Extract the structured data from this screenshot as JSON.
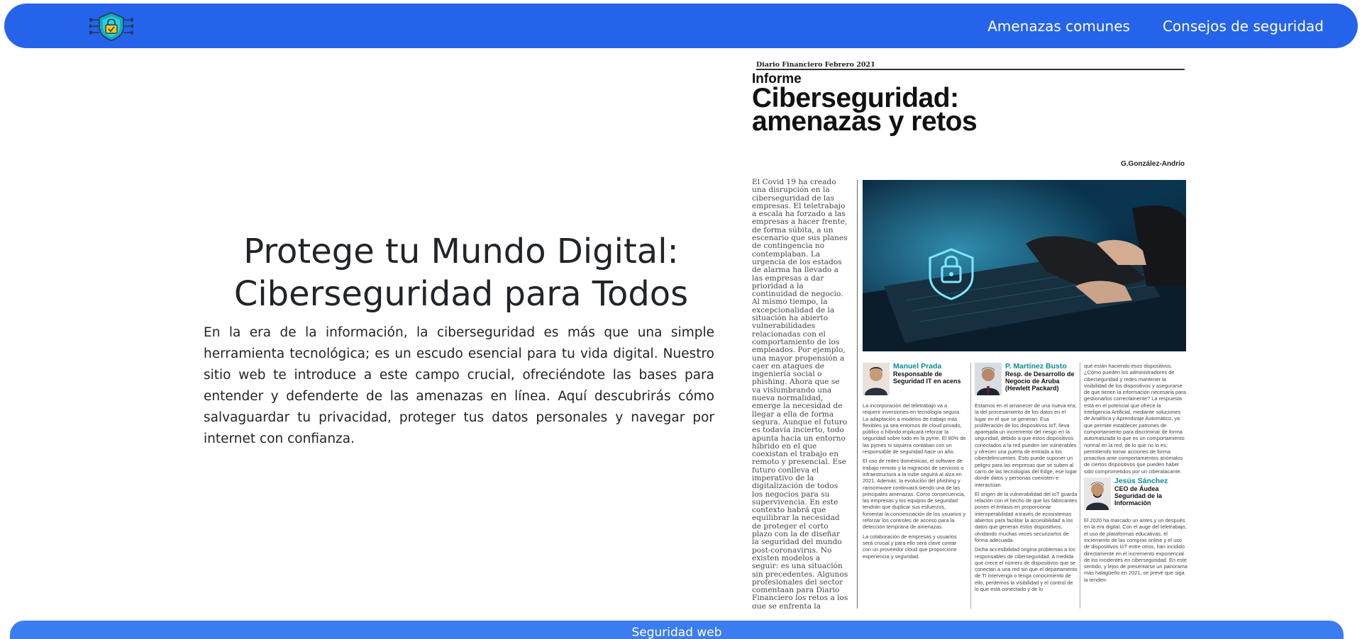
{
  "header": {
    "logo_icon": "shield-lock-icon",
    "nav": [
      {
        "label": "Amenazas comunes"
      },
      {
        "label": "Consejos de seguridad"
      }
    ]
  },
  "hero": {
    "title_line1": "Protege tu Mundo Digital:",
    "title_line2": "Ciberseguridad para Todos",
    "paragraph": "En la era de la información, la ciberseguridad es más que una simple herramienta tecnológica; es un escudo esencial para tu vida digital. Nuestro sitio web te introduce a este campo crucial, ofreciéndote las bases para entender y defenderte de las amenazas en línea. Aquí descubrirás cómo salvaguardar tu privacidad, proteger tus datos personales y navegar por internet con confianza."
  },
  "article": {
    "masthead": "Diario Financiero Febrero 2021",
    "kicker": "Informe",
    "headline_line1": "Ciberseguridad:",
    "headline_line2": "amenazas y retos",
    "byline": "G.González-Andrío",
    "column1": "El Covid 19 ha creado una disrupción en la ciberseguridad de las empresas. El teletrabajo a escala ha forzado a las empresas a hacer frente, de forma súbita, a un escenario que sus planes de contingencia no contemplaban. La urgencia de los estados de alarma ha llevado a las empresas a dar prioridad a la continuidad de negocio. Al mismo tiempo, la excepcionalidad de la situación ha abierto vulnerabilidades relacionadas con el comportamiento de los empleados. Por ejemplo, una mayor propensión a caer en ataques de ingeniería social o phishing. Ahora que se va vislumbrando una nueva normalidad, emerge la necesidad de llegar a ella de forma segura. Aunque el futuro es todavía incierto, todo apunta hacia un entorno híbrido en el que coexistan el trabajo en remoto y presencial. Ese futuro conlleva el imperativo de la digitalización de todos los negocios para su supervivencia. En este contexto habrá que equilibrar la necesidad de proteger el corto plazo con la de diseñar la seguridad del mundo post-coronavirus. No existen modelos a seguir: es una situación sin precedentes. Algunos profesionales del sector comentaan para Diario Financiero los retos a los que se enfrenta la Ciberseguridad tanto en nuestro país como en el resto del mundo.",
    "profiles": [
      {
        "name": "Manuel Prada",
        "role": "Responsable de Seguridad IT en acens",
        "text": [
          "La incorporación del teletrabajo va a requerir inversiones en tecnología segura. La adaptación a modelos de trabajo más flexibles ya sea entornos de cloud privado, público o híbrido implicará reforzar la seguridad sobre todo en la pyme. El 90% de las pymes ni siquiera contaban con un responsable de seguridad hace un año.",
          "El uso de redes domésticas, el software de trabajo remoto y la migración de servicios o infraestructura a la nube seguirá al alza en 2021. Además, la evolución del phishing y ransomware continuará siendo una de las principales amenazas. Como consecuencia, las empresas y los equipos de seguridad tendrán que duplicar sus esfuerzos, fomentar la concienciación de los usuarios y reforzar los controles de acceso para la detección temprana de amenazas.",
          "La colaboración de empresas y usuarios será crucial y para ello será clave contar con un proveedor cloud que proporcione experiencia y seguridad."
        ]
      },
      {
        "name": "P. Martínez Busto",
        "role": "Resp. de Desarrollo de Negocio de Aruba (Hewlett Packard)",
        "text": [
          "Estamos en el amanecer de una nueva era; la del procesamiento de los datos en el lugar en el que se generan. Esa proliferación de los dispositivos IoT, lleva aparejada un incremento del riesgo en la seguridad, debido a que estos dispositivos conectados a la red pueden ser vulnerables y ofrecen una puerta de entrada a los ciberdelincuentes. Esto puede suponer un peligro para las empresas que se suben al carro de las tecnologías del Edge, ese lugar donde datos y personas coexisten e interactúan.",
          "El origen de la vulnerabilidad del IoT guarda relación con el hecho de que los fabricantes ponen el énfasis en proporcionar interoperabilidad a través de ecosistemas abiertos para facilitar la accesibilidad a los datos que generan estos dispositivos, olvidando muchas veces securizarlos de forma adecuada.",
          "Dicha accesibilidad origina problemas a los responsables de ciberseguridad. A medida que crece el número de dispositivos que se conectan a una red sin que el departamento de TI intervenga o tenga conocimiento de ello, perdemos la visibilidad y el control de lo que está conectado y de lo"
        ]
      },
      {
        "name": "Jesús Sánchez",
        "role": "CEO de Áudea Seguridad de la Información",
        "lead_text": "qué están haciendo esos dispositivos. ¿Cómo pueden los administradores de ciberseguridad y redes mantener la visibilidad de los dispositivos y asegurarse de que tienen la información necesaria para gestionarlos correctamente? La respuesta está en el potencial que ofrece la Inteligencia Artificial, mediante soluciones de Analítica y Aprendizaje Automático, ya que permite establecer patrones de comportamiento para discriminar de forma automatizada lo que es un comportamiento normal en la red, de lo que no lo es; permitiendo tomar acciones de forma proactiva ante comportamientos anómalos de ciertos dispositivos que pueden haber sido comprometidos por un ciberatacante.",
        "text": [
          "El 2020 ha marcado un antes y un después en la era digital. Con el auge del teletrabajo, el uso de plataformas educativas, el incremento de las compras online y el uso de dispositivos IoT entre otros, han incidido directamente en el incremento exponencial de los incidentes en ciberseguridad. En este sentido, y lejos de presentarse un panorama más halagüeño en 2021, se prevé que siga la tenden-"
        ]
      }
    ]
  },
  "footer": {
    "label": "Seguridad web"
  },
  "colors": {
    "navbar": "#2563eb",
    "footer": "#3b7cf0",
    "accent_name": "#0e8b95"
  }
}
